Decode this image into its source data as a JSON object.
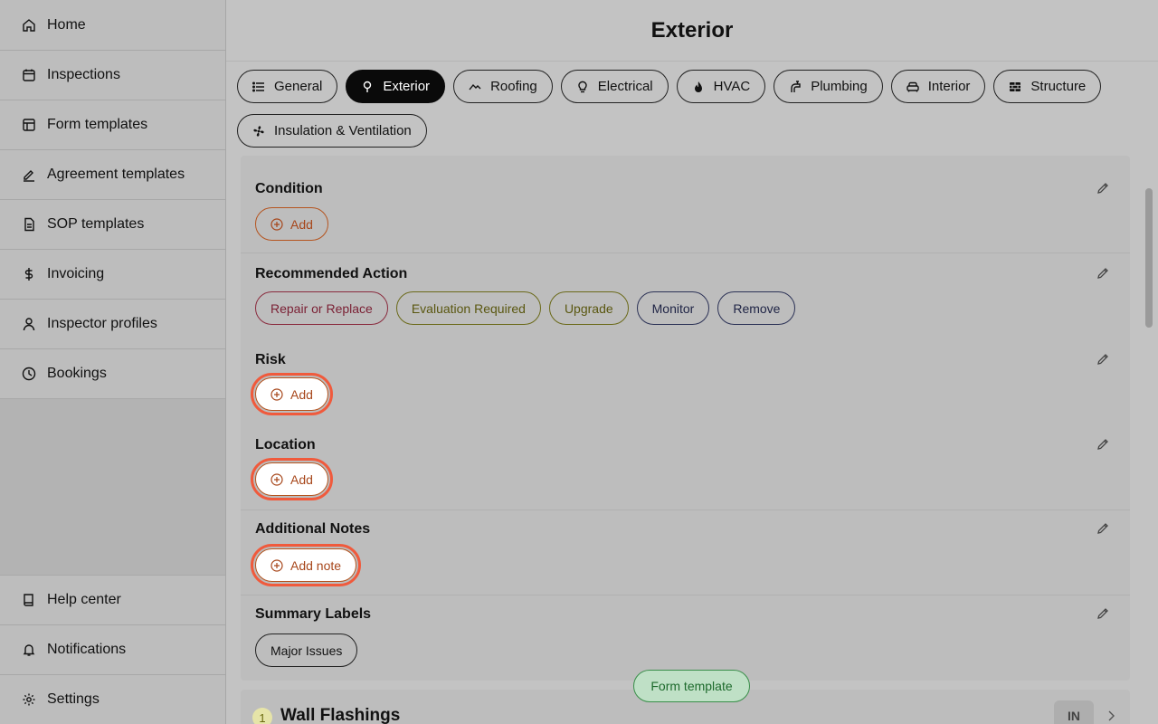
{
  "sidebar": {
    "items": [
      {
        "label": "Home",
        "icon": "home-icon"
      },
      {
        "label": "Inspections",
        "icon": "calendar-icon"
      },
      {
        "label": "Form templates",
        "icon": "layout-icon"
      },
      {
        "label": "Agreement templates",
        "icon": "signature-icon"
      },
      {
        "label": "SOP templates",
        "icon": "document-icon"
      },
      {
        "label": "Invoicing",
        "icon": "dollar-icon"
      },
      {
        "label": "Inspector profiles",
        "icon": "user-icon"
      },
      {
        "label": "Bookings",
        "icon": "clock-icon"
      }
    ],
    "bottom_items": [
      {
        "label": "Help center",
        "icon": "book-icon"
      },
      {
        "label": "Notifications",
        "icon": "bell-icon"
      },
      {
        "label": "Settings",
        "icon": "gear-icon"
      }
    ]
  },
  "header": {
    "title": "Exterior"
  },
  "tabs": [
    {
      "label": "General",
      "icon": "list-icon"
    },
    {
      "label": "Exterior",
      "icon": "tree-icon",
      "active": true
    },
    {
      "label": "Roofing",
      "icon": "roof-icon"
    },
    {
      "label": "Electrical",
      "icon": "bulb-icon"
    },
    {
      "label": "HVAC",
      "icon": "flame-icon"
    },
    {
      "label": "Plumbing",
      "icon": "faucet-icon"
    },
    {
      "label": "Interior",
      "icon": "sofa-icon"
    },
    {
      "label": "Structure",
      "icon": "bricks-icon"
    },
    {
      "label": "Insulation & Ventilation",
      "icon": "fan-icon"
    }
  ],
  "sections": {
    "condition": {
      "title": "Condition",
      "add_label": "Add"
    },
    "recommended_action": {
      "title": "Recommended Action",
      "chips": [
        "Repair or Replace",
        "Evaluation Required",
        "Upgrade",
        "Monitor",
        "Remove"
      ]
    },
    "risk": {
      "title": "Risk",
      "add_label": "Add"
    },
    "location": {
      "title": "Location",
      "add_label": "Add"
    },
    "additional_notes": {
      "title": "Additional Notes",
      "add_label": "Add note"
    },
    "summary_labels": {
      "title": "Summary Labels",
      "chips": [
        "Major Issues"
      ]
    }
  },
  "float_pill": {
    "label": "Form template"
  },
  "next_item": {
    "number": "1",
    "title": "Wall Flashings",
    "badge": "IN"
  },
  "colors": {
    "accent": "#a7461a",
    "highlight": "#f05a3c",
    "pill_green": "#1d6a2c"
  }
}
